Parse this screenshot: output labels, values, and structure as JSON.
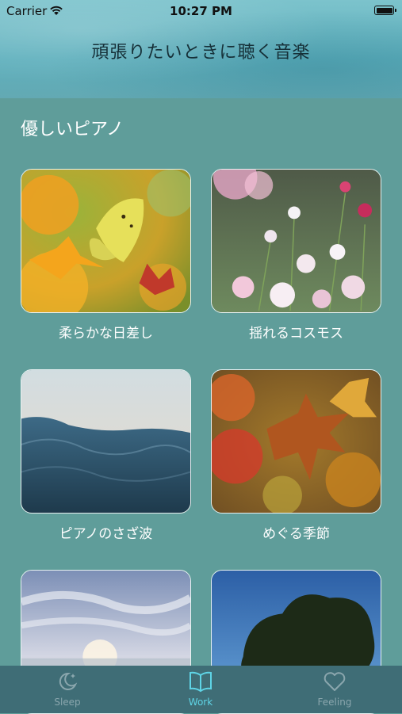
{
  "status_bar": {
    "carrier": "Carrier",
    "time": "10:27 PM"
  },
  "header": {
    "title": "頑張りたいときに聴く音楽"
  },
  "section": {
    "title": "優しいピアノ"
  },
  "cards": [
    {
      "title": "柔らかな日差し"
    },
    {
      "title": "揺れるコスモス"
    },
    {
      "title": "ピアノのさざ波"
    },
    {
      "title": "めぐる季節"
    },
    {
      "title": ""
    },
    {
      "title": ""
    }
  ],
  "tab_bar": {
    "tabs": [
      {
        "label": "Sleep",
        "icon": "moon-stars-icon"
      },
      {
        "label": "Work",
        "icon": "book-icon",
        "selected": true
      },
      {
        "label": "Feeling",
        "icon": "heart-icon"
      }
    ]
  },
  "colors": {
    "background": "#5f9d9a",
    "tab_bar": "#3f6d76",
    "tab_active": "#5fd4e6",
    "tab_inactive": "#8aa6ad"
  }
}
